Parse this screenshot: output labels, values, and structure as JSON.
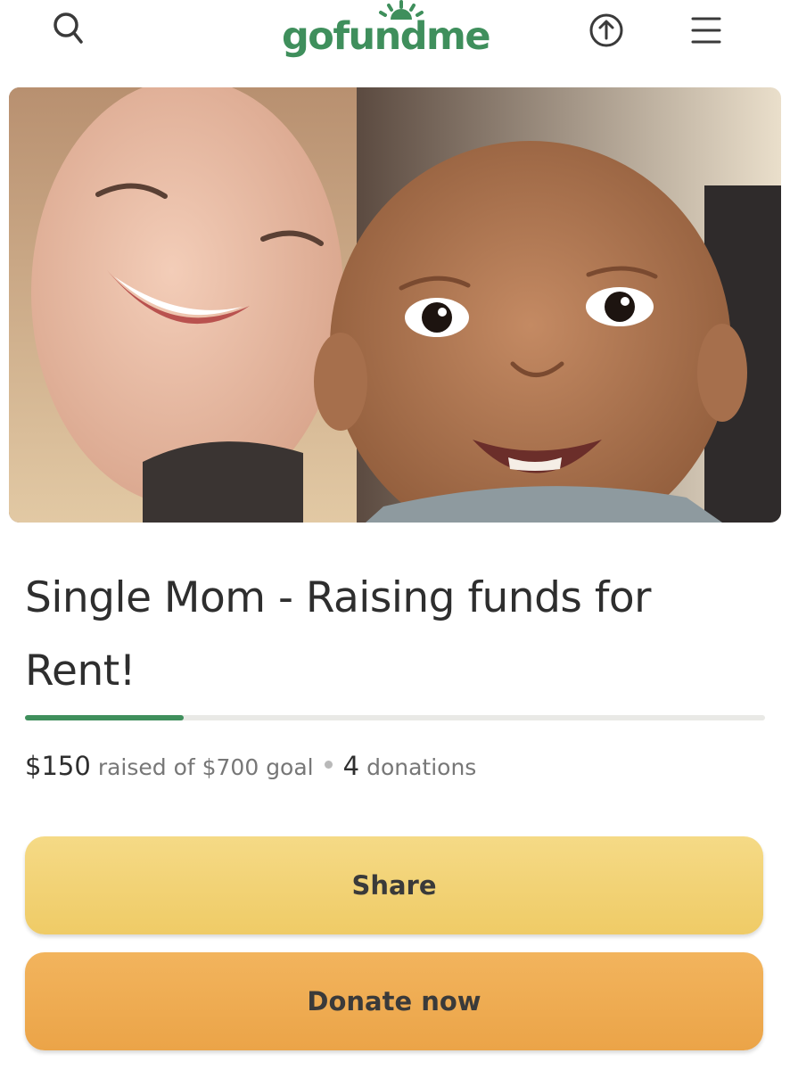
{
  "header": {
    "logo_text": "gofundme",
    "icons": [
      "search-icon",
      "upload-share-icon",
      "hamburger-menu-icon"
    ]
  },
  "campaign": {
    "title": "Single Mom - Raising funds for Rent!",
    "raised": "$150",
    "raised_label": "raised of $700 goal",
    "donation_count": "4",
    "donation_label": "donations",
    "progress_fraction": 0.214
  },
  "actions": {
    "share_label": "Share",
    "donate_label": "Donate now"
  },
  "colors": {
    "brand_green": "#3f8f5c",
    "share_button": "#f2d478",
    "donate_button": "#eeac52"
  }
}
